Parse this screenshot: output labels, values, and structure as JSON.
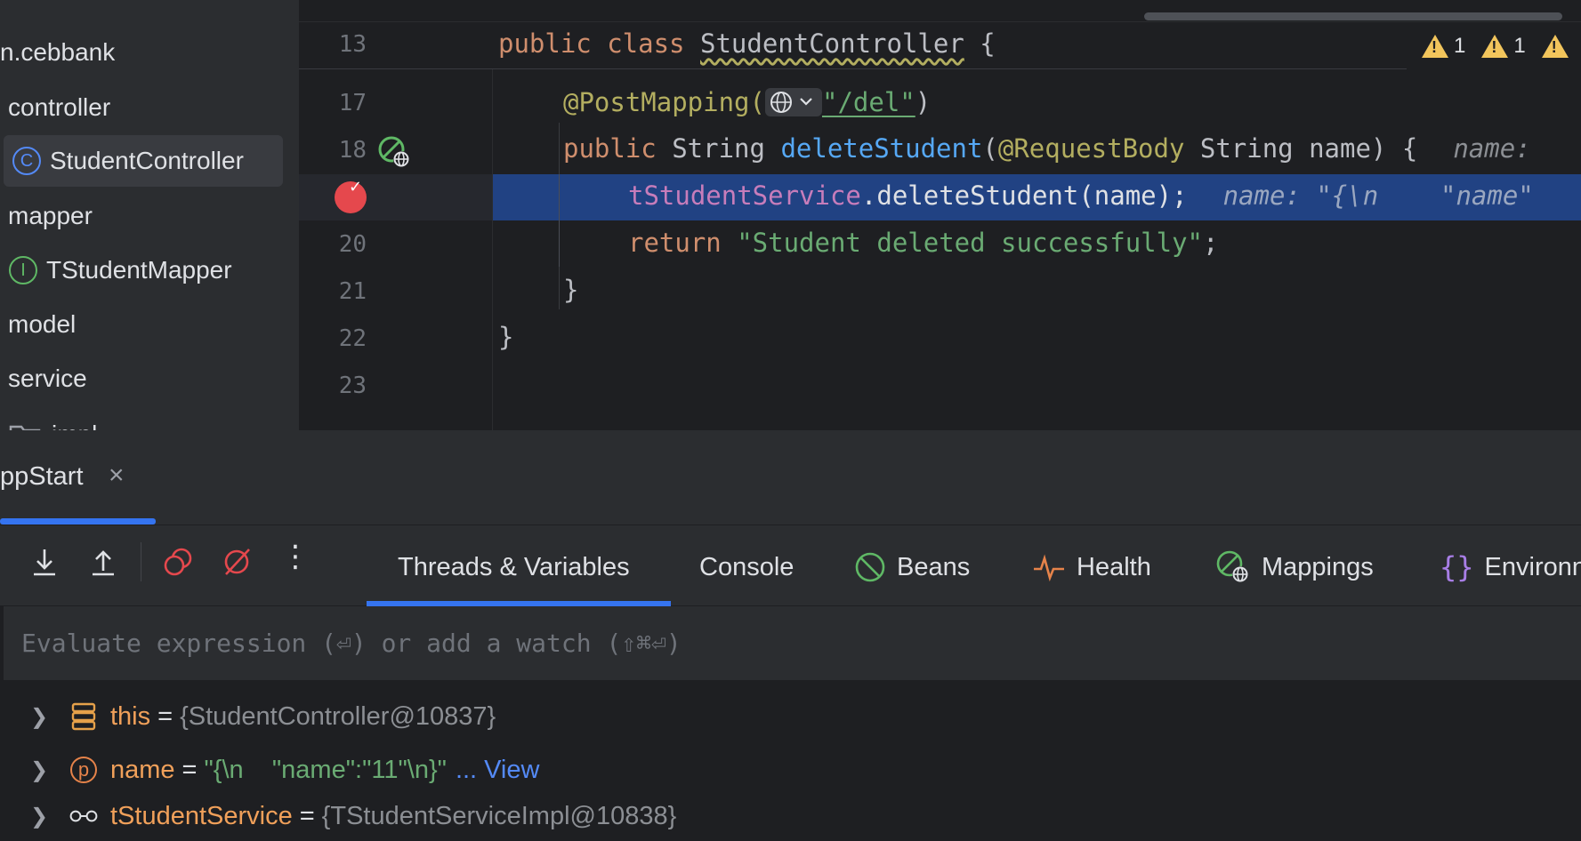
{
  "project_tree": {
    "items": [
      {
        "label": "n.cebbank",
        "icon": "package-icon"
      },
      {
        "label": "controller",
        "icon": "package-icon"
      },
      {
        "label": "StudentController",
        "icon": "class-icon",
        "selected": true
      },
      {
        "label": "mapper",
        "icon": "package-icon"
      },
      {
        "label": "TStudentMapper",
        "icon": "interface-icon"
      },
      {
        "label": "model",
        "icon": "package-icon"
      },
      {
        "label": "service",
        "icon": "package-icon"
      },
      {
        "label": "impl",
        "icon": "folder-icon"
      }
    ],
    "class_glyph": "C",
    "interface_glyph": "I"
  },
  "editor": {
    "warnings": [
      {
        "count": "1"
      },
      {
        "count": "1"
      }
    ],
    "lines": [
      {
        "num": "13"
      },
      {
        "num": "17"
      },
      {
        "num": "18"
      },
      {
        "num": ""
      },
      {
        "num": "20"
      },
      {
        "num": "21"
      },
      {
        "num": "22"
      },
      {
        "num": "23"
      }
    ],
    "code": {
      "l13_kw": "public class ",
      "l13_name": "StudentController",
      "l13_rest": " {",
      "l17_ann": "@PostMapping(",
      "l17_str": "\"/del\"",
      "l17_end": ")",
      "l18_kw": "public ",
      "l18_type": "String ",
      "l18_fn": "deleteStudent",
      "l18_p1": "(",
      "l18_ann": "@RequestBody",
      "l18_rest": " String name) {",
      "l18_hint": "name:",
      "l19_fld": "tStudentService",
      "l19_rest": ".deleteStudent(name);",
      "l19_hint": "name: \"{\\n    \"name\"",
      "l20_kw": "return ",
      "l20_str": "\"Student deleted successfully\"",
      "l20_end": ";",
      "l21": "}",
      "l22": "}"
    }
  },
  "tool_window": {
    "run_tab": "ppStart",
    "close_glyph": "×"
  },
  "toolbar": {
    "tabs": [
      {
        "label": "Threads & Variables",
        "icon": ""
      },
      {
        "label": "Console",
        "icon": ""
      },
      {
        "label": "Beans",
        "icon": "beans-icon"
      },
      {
        "label": "Health",
        "icon": "health-icon"
      },
      {
        "label": "Mappings",
        "icon": "mappings-icon"
      },
      {
        "label": "Environn",
        "icon": "braces-icon"
      }
    ],
    "more_glyph": "⋮"
  },
  "evaluate": {
    "placeholder": "Evaluate expression (⏎) or add a watch (⇧⌘⏎)"
  },
  "variables": [
    {
      "name": "this",
      "eq": "=",
      "value": "{StudentController@10837}",
      "icon": "object-icon"
    },
    {
      "name": "name",
      "eq": "=",
      "value": "\"{\\n    \"name\":\"11\"\\n}\"",
      "more": "...",
      "link": "View",
      "icon": "parameter-icon",
      "glyph": "p"
    },
    {
      "name": "tStudentService",
      "eq": "=",
      "value": "{TStudentServiceImpl@10838}",
      "icon": "watch-icon"
    }
  ],
  "colors": {
    "accent": "#3574f0",
    "breakpoint": "#e5484d",
    "exec_line": "#214283",
    "warning": "#f2c55c"
  }
}
